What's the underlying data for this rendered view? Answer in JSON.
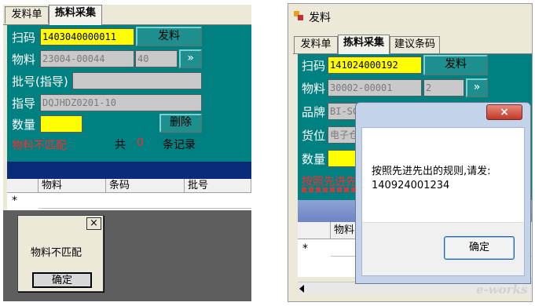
{
  "left": {
    "tabs": [
      {
        "label": "发料单"
      },
      {
        "label": "拣料采集"
      }
    ],
    "fields": {
      "scan_label": "扫码",
      "scan_value": "1403040000011",
      "issue_button": "发料",
      "material_label": "物料",
      "material_code": "23004-00044",
      "material_qty": "40",
      "arrow_button": "»",
      "batch_label": "批号(指导)",
      "batch_value": "",
      "guide_label": "指导",
      "guide_value": "DQJHDZ0201-10",
      "qty_label": "数量",
      "qty_value": "",
      "delete_button": "删除"
    },
    "status": {
      "error_text": "物料不匹配",
      "count_prefix": "共",
      "count_value": "0",
      "count_suffix": "条记录"
    },
    "grid": {
      "columns": [
        "物料",
        "条码",
        "批号"
      ],
      "new_row_marker": "*"
    },
    "dialog": {
      "close": "×",
      "message": "物料不匹配",
      "ok": "确定"
    }
  },
  "right": {
    "window_title": "发料",
    "tabs": [
      {
        "label": "发料单"
      },
      {
        "label": "拣料采集"
      },
      {
        "label": "建议条码"
      }
    ],
    "fields": {
      "scan_label": "扫码",
      "scan_value": "141024000192",
      "issue_button": "发料",
      "material_label": "物料",
      "material_code": "30002-00001",
      "material_qty": "2",
      "arrow_button": "»",
      "brand_label": "品牌",
      "brand_value": "BI-SC",
      "location_label": "货位",
      "location_value": "电子仓",
      "qty_label": "数量",
      "qty_value": ""
    },
    "status": {
      "error_text": "按照先进先出"
    },
    "grid": {
      "columns": [
        "物料"
      ],
      "new_row_marker": "*"
    },
    "dialog": {
      "close": "×",
      "message_line1": "按照先进先出的规则,请发:",
      "message_line2": "140924001234",
      "ok": "确定"
    },
    "watermark": "e-works"
  }
}
